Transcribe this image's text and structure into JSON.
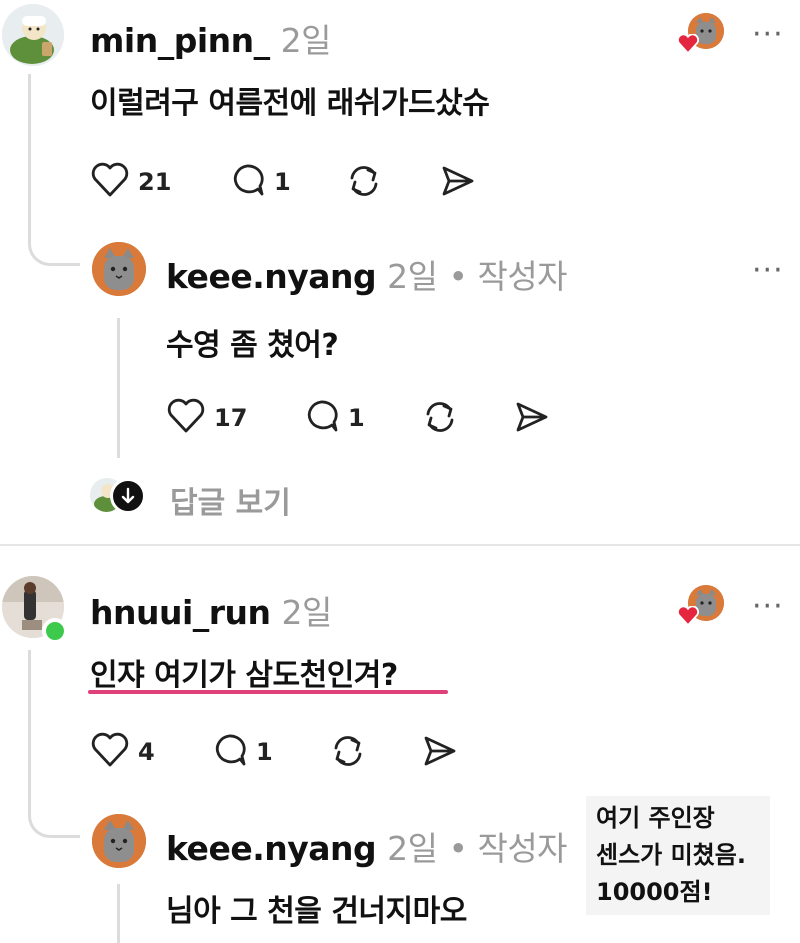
{
  "comment1": {
    "username": "min_pinn_",
    "time": "2일",
    "text": "이럴려구 여름전에 래쉬가드샀슈",
    "likes": "21",
    "replies": "1"
  },
  "reply1": {
    "username": "keee.nyang",
    "time": "2일",
    "author_badge": "• 작성자",
    "text": "수영 좀 쳤어?",
    "likes": "17",
    "replies": "1"
  },
  "view_replies": {
    "label": "답글 보기"
  },
  "comment2": {
    "username": "hnuui_run",
    "time": "2일",
    "text": "인쟈 여기가 삼도천인겨?",
    "likes": "4",
    "replies": "1"
  },
  "reply2": {
    "username": "keee.nyang",
    "time": "2일",
    "author_badge": "• 작성자",
    "text": "님아 그 천을 건너지마오"
  },
  "note": {
    "line1": "여기 주인장",
    "line2": "센스가 미쳤음.",
    "line3": "10000점!"
  },
  "more_label": "···",
  "colors": {
    "accent_underline": "#e0407a",
    "heart_red": "#e5263f",
    "online_green": "#3cc94c"
  }
}
